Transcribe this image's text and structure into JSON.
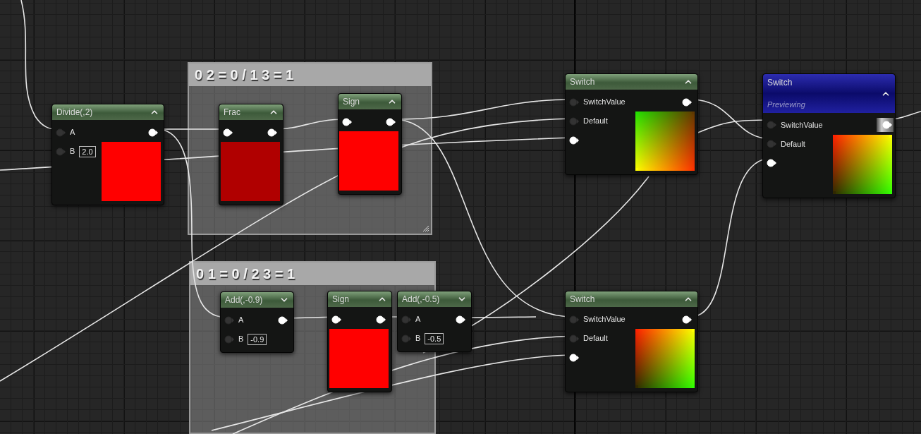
{
  "comments": [
    {
      "title": "0 2 = 0 / 1 3 = 1"
    },
    {
      "title": "0 1 = 0 / 2 3 = 1"
    }
  ],
  "nodes": [
    {
      "title": "Divide(,2)",
      "previewing": false,
      "expanded": true,
      "inputs": [
        {
          "label": "A",
          "connected": false
        },
        {
          "label": "B",
          "connected": false,
          "value": "2.0"
        }
      ],
      "output": {
        "highlighted": false
      },
      "preview": {
        "kind": "solid",
        "color": "#ff0000"
      }
    },
    {
      "title": "Frac",
      "previewing": false,
      "expanded": true,
      "inputs": [
        {
          "connected": true
        }
      ],
      "output": {
        "highlighted": false
      },
      "preview": {
        "kind": "solid",
        "color": "#b00000"
      }
    },
    {
      "title": "Sign",
      "previewing": false,
      "expanded": true,
      "inputs": [
        {
          "connected": true
        }
      ],
      "output": {
        "highlighted": false
      },
      "preview": {
        "kind": "solid",
        "color": "#ff0000"
      }
    },
    {
      "title": "Add(,-0.9)",
      "previewing": false,
      "expanded": false,
      "inputs": [
        {
          "label": "A",
          "connected": false
        },
        {
          "label": "B",
          "connected": false,
          "value": "-0.9"
        }
      ],
      "output": {
        "highlighted": false
      }
    },
    {
      "title": "Sign",
      "previewing": false,
      "expanded": true,
      "inputs": [
        {
          "connected": true
        }
      ],
      "output": {
        "highlighted": false
      },
      "preview": {
        "kind": "solid",
        "color": "#ff0000"
      }
    },
    {
      "title": "Add(,-0.5)",
      "previewing": false,
      "expanded": false,
      "inputs": [
        {
          "label": "A",
          "connected": false
        },
        {
          "label": "B",
          "connected": false,
          "value": "-0.5"
        }
      ],
      "output": {
        "highlighted": false
      }
    },
    {
      "title": "Switch",
      "previewing": false,
      "expanded": true,
      "inputs": [
        {
          "label": "SwitchValue",
          "connected": false
        },
        {
          "label": "Default",
          "connected": false
        },
        {
          "connected": true
        }
      ],
      "output": {
        "highlighted": false
      },
      "preview": {
        "kind": "gradient",
        "corners": [
          {
            "color": "#20e000"
          },
          {
            "color": "#603800"
          },
          {
            "color": "#ffff00"
          },
          {
            "color": "#ff3000"
          }
        ]
      }
    },
    {
      "title": "Switch",
      "subtitle": "Previewing",
      "previewing": true,
      "expanded": true,
      "inputs": [
        {
          "label": "SwitchValue",
          "connected": false
        },
        {
          "label": "Default",
          "connected": false
        },
        {
          "connected": true
        }
      ],
      "output": {
        "highlighted": true
      },
      "preview": {
        "kind": "gradient",
        "corners": [
          {
            "color": "#ff2000"
          },
          {
            "color": "#ffff00"
          },
          {
            "color": "#302800"
          },
          {
            "color": "#30ff00"
          }
        ]
      }
    },
    {
      "title": "Switch",
      "previewing": false,
      "expanded": true,
      "inputs": [
        {
          "label": "SwitchValue",
          "connected": false
        },
        {
          "label": "Default",
          "connected": false
        },
        {
          "connected": true
        }
      ],
      "output": {
        "highlighted": false
      },
      "preview": {
        "kind": "gradient",
        "corners": [
          {
            "color": "#ff2000"
          },
          {
            "color": "#ffff00"
          },
          {
            "color": "#302800"
          },
          {
            "color": "#30ff00"
          }
        ]
      }
    }
  ]
}
